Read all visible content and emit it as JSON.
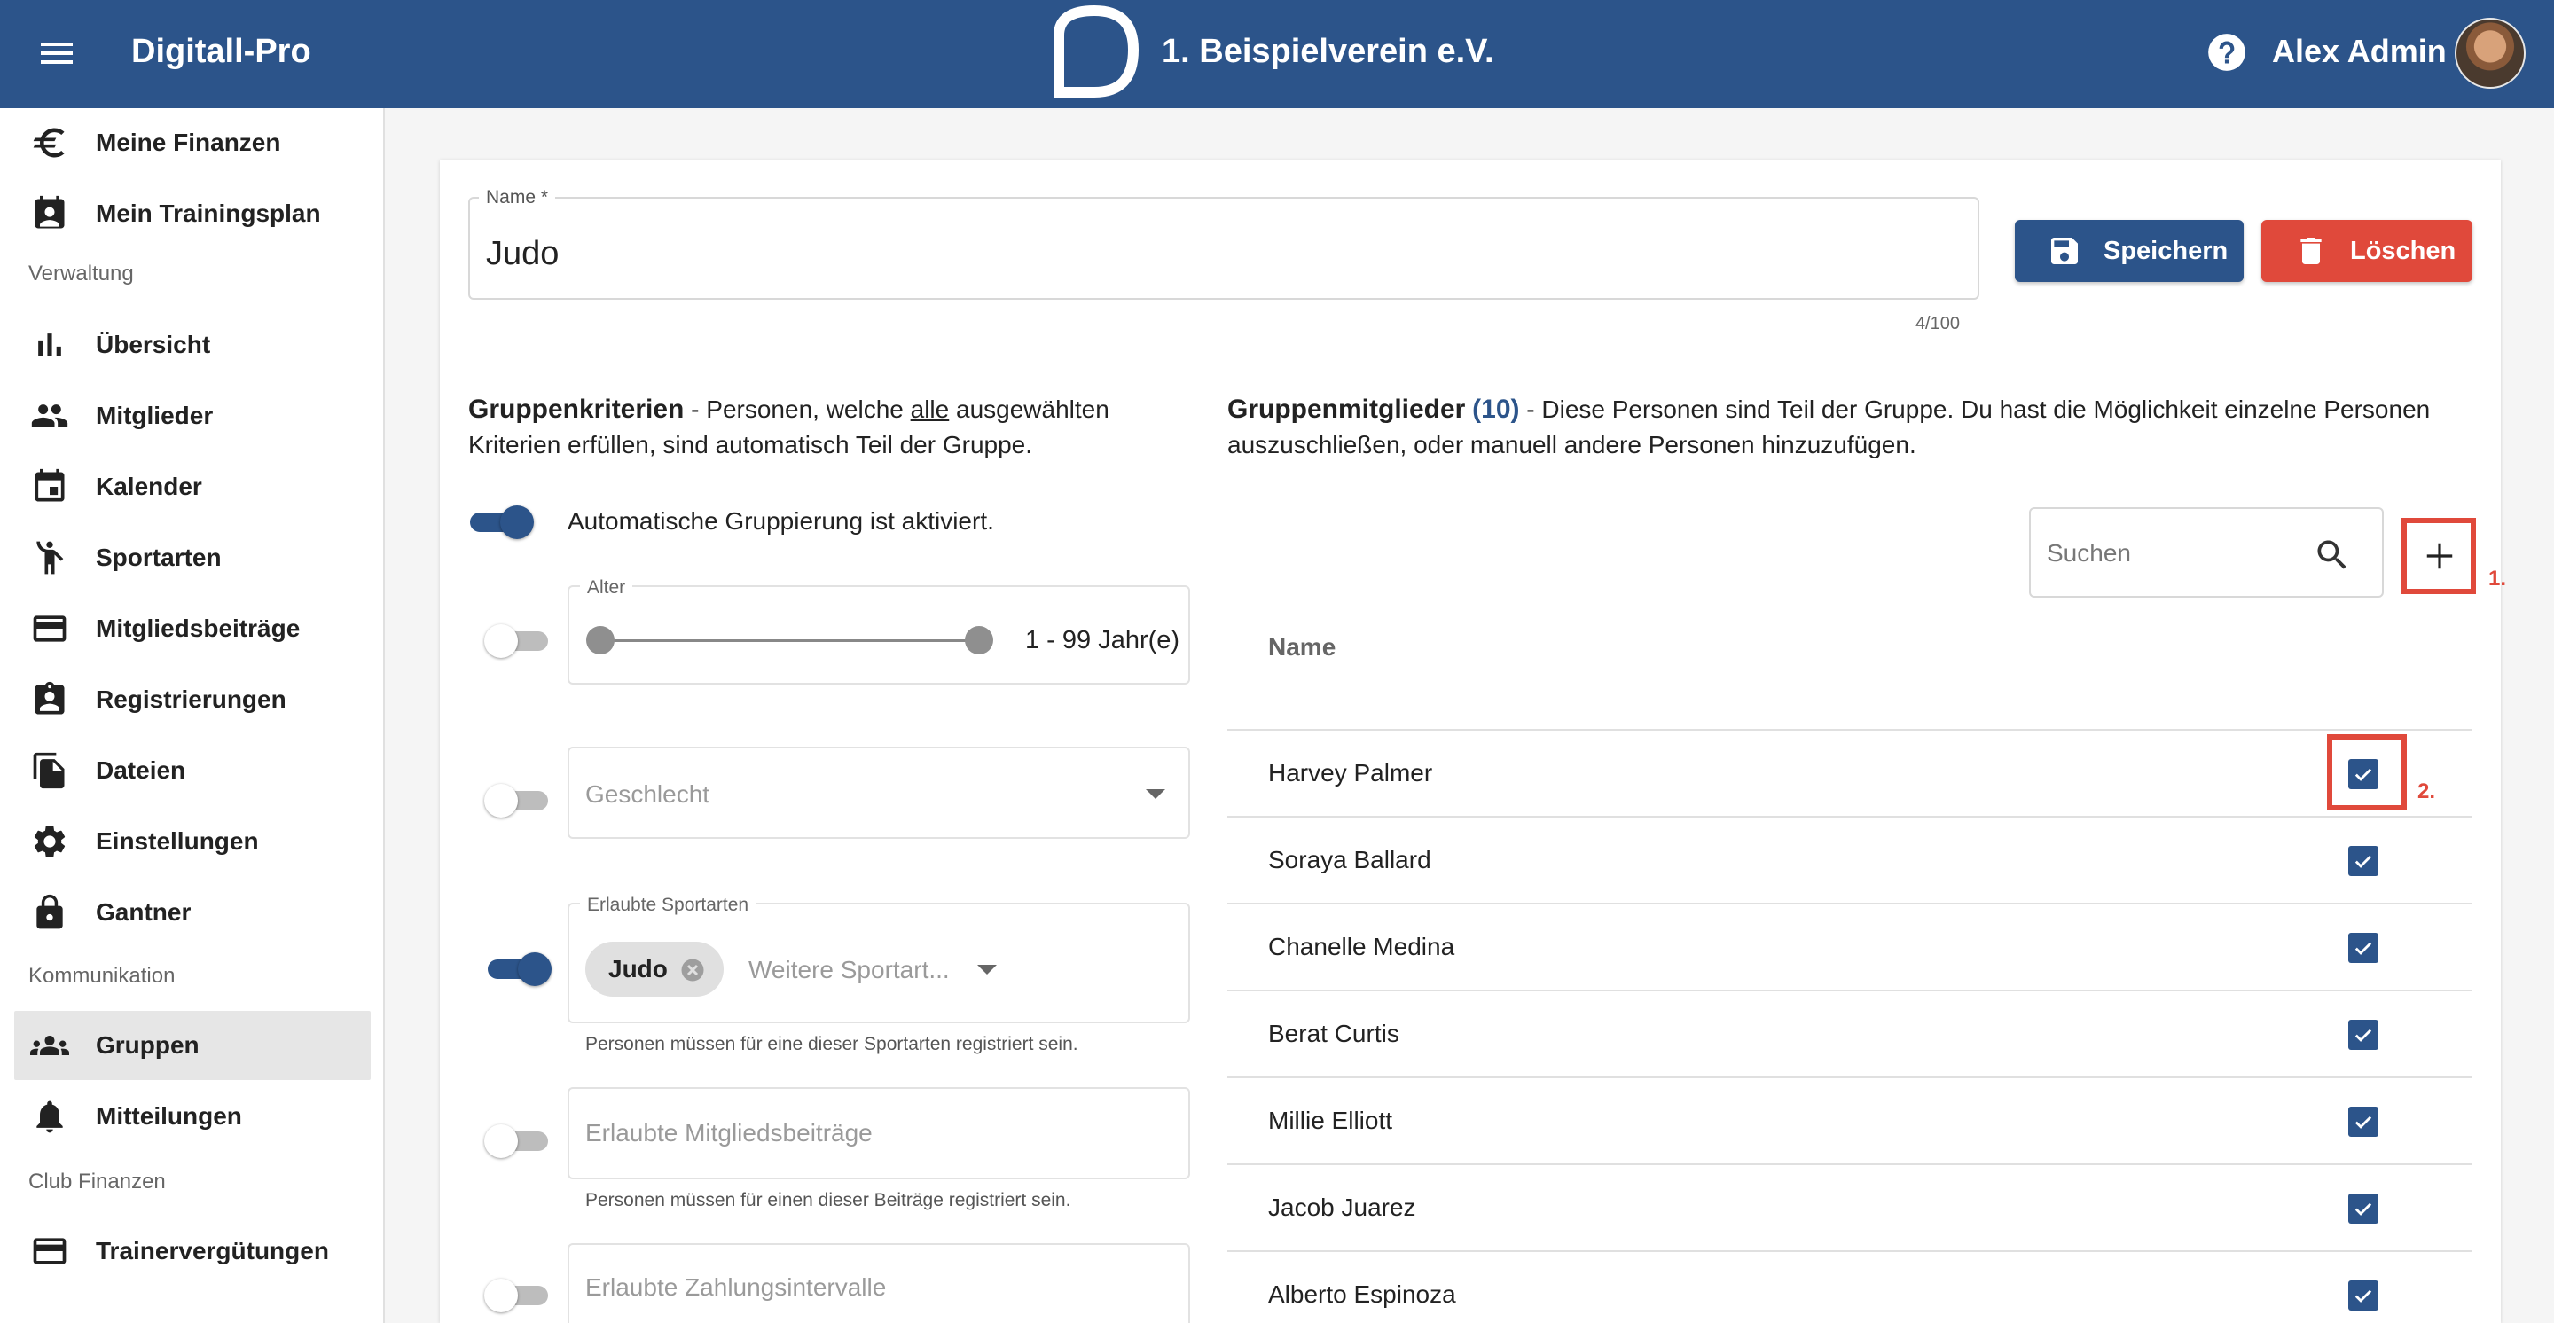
{
  "header": {
    "app_title": "Digitall-Pro",
    "club_name": "1. Beispielverein e.V.",
    "user_name": "Alex Admin"
  },
  "colors": {
    "primary": "#2c548a",
    "danger": "#e0493b",
    "annotation": "#e0493b"
  },
  "sidebar": {
    "items_top": [
      {
        "label": "Meine Finanzen",
        "icon": "euro-icon"
      },
      {
        "label": "Mein Trainingsplan",
        "icon": "calendar-person-icon"
      }
    ],
    "section_verwaltung": "Verwaltung",
    "items_verwaltung": [
      {
        "label": "Übersicht",
        "icon": "bar-chart-icon"
      },
      {
        "label": "Mitglieder",
        "icon": "people-icon"
      },
      {
        "label": "Kalender",
        "icon": "calendar-icon"
      },
      {
        "label": "Sportarten",
        "icon": "sport-icon"
      },
      {
        "label": "Mitgliedsbeiträge",
        "icon": "credit-card-icon"
      },
      {
        "label": "Registrierungen",
        "icon": "badge-icon"
      },
      {
        "label": "Dateien",
        "icon": "file-icon"
      },
      {
        "label": "Einstellungen",
        "icon": "gear-icon"
      },
      {
        "label": "Gantner",
        "icon": "lock-icon"
      }
    ],
    "section_kommunikation": "Kommunikation",
    "items_kommunikation": [
      {
        "label": "Gruppen",
        "icon": "groups-icon",
        "active": true
      },
      {
        "label": "Mitteilungen",
        "icon": "bell-icon"
      }
    ],
    "section_club_finanzen": "Club Finanzen",
    "items_club_finanzen": [
      {
        "label": "Trainervergütungen",
        "icon": "credit-card-icon"
      }
    ]
  },
  "form": {
    "name_label": "Name *",
    "name_value": "Judo",
    "char_count": "4/100",
    "save_label": "Speichern",
    "delete_label": "Löschen"
  },
  "criteria": {
    "title": "Gruppenkriterien",
    "desc_a": " - Personen, welche ",
    "desc_underlined": "alle",
    "desc_b": " ausgewählten",
    "desc_line2": "Kriterien erfüllen, sind automatisch Teil der Gruppe.",
    "auto_label": "Automatische Gruppierung ist aktiviert.",
    "auto_enabled": true,
    "age": {
      "label": "Alter",
      "min": 1,
      "max": 99,
      "value_text": "1 - 99 Jahr(e)",
      "enabled": false
    },
    "gender": {
      "placeholder": "Geschlecht",
      "enabled": false
    },
    "sports": {
      "label": "Erlaubte Sportarten",
      "chip": "Judo",
      "placeholder": "Weitere Sportart...",
      "hint": "Personen müssen für eine dieser Sportarten registriert sein.",
      "enabled": true
    },
    "fees": {
      "placeholder": "Erlaubte Mitgliedsbeiträge",
      "hint": "Personen müssen für einen dieser Beiträge registriert sein.",
      "enabled": false
    },
    "intervals": {
      "placeholder": "Erlaubte Zahlungsintervalle",
      "enabled": false
    }
  },
  "members": {
    "title": "Gruppenmitglieder",
    "count": "(10)",
    "desc_line1": " - Diese Personen sind Teil der Gruppe. Du hast die Möglichkeit einzelne Personen",
    "desc_line2": "auszuschließen, oder manuell andere Personen hinzuzufügen.",
    "search_placeholder": "Suchen",
    "column_name": "Name",
    "annotation_add": "1.",
    "annotation_checkbox": "2.",
    "rows": [
      {
        "name": "Harvey Palmer",
        "checked": true
      },
      {
        "name": "Soraya Ballard",
        "checked": true
      },
      {
        "name": "Chanelle Medina",
        "checked": true
      },
      {
        "name": "Berat Curtis",
        "checked": true
      },
      {
        "name": "Millie Elliott",
        "checked": true
      },
      {
        "name": "Jacob Juarez",
        "checked": true
      },
      {
        "name": "Alberto Espinoza",
        "checked": true
      }
    ]
  }
}
